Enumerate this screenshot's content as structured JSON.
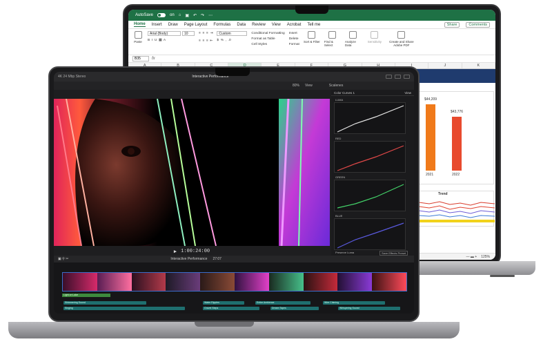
{
  "excel": {
    "autosave_label": "AutoSave",
    "autosave_state": "on",
    "tabs": [
      "Home",
      "Insert",
      "Draw",
      "Page Layout",
      "Formulas",
      "Data",
      "Review",
      "View",
      "Acrobat",
      "Tell me"
    ],
    "active_tab": "Home",
    "share_label": "Share",
    "comments_label": "Comments",
    "paste_label": "Paste",
    "font_name": "Arial (Body)",
    "font_size": "10",
    "number_format": "Custom",
    "conditional_formatting": "Conditional Formatting",
    "format_as_table": "Format as Table",
    "cell_styles": "Cell Styles",
    "insert_label": "Insert",
    "delete_label": "Delete",
    "format_label": "Format",
    "sort_filter": "Sort & Filter",
    "find_select": "Find & Select",
    "analyze_data": "Analyze Data",
    "sensitivity": "Sensitivity",
    "create_share_pdf": "Create and Share Adobe PDF",
    "name_box": "B35",
    "fx": "fx",
    "columns": [
      "A",
      "B",
      "C",
      "D",
      "E",
      "F",
      "G",
      "H",
      "I",
      "J",
      "K"
    ],
    "selected_column": "D",
    "chart_bar_values": [
      "$44,209",
      "$43,776"
    ],
    "chart_bar_years": [
      "2021",
      "2022"
    ],
    "trend_title": "Trend",
    "zoom": "125%"
  },
  "fcp": {
    "library": "4K 24 Mbp Stereo",
    "project_title": "Interactive Performance",
    "zoom": "80%",
    "view_label": "View",
    "inspector_tab": "Scalenes",
    "color_curves_title": "Color Curves 1",
    "curves": [
      "LUMA",
      "RED",
      "GREEN",
      "BLUE"
    ],
    "preserve_luma": "Preserve Luma",
    "save_effects": "Save Effects Preset",
    "timecode": "1:00:24:00",
    "timeline_title": "Interactive Performance",
    "timeline_duration": "27:07",
    "audio_clips": [
      "Shimmering Sound",
      "Water Ripples",
      "Entire Ambience",
      "Wire Chiming",
      "Singing",
      "Gravel Steps",
      "Dream Tapes",
      "Whispering Sound"
    ],
    "green_clip": "Light on Lake",
    "accent_blue": "#3b6cc9"
  }
}
